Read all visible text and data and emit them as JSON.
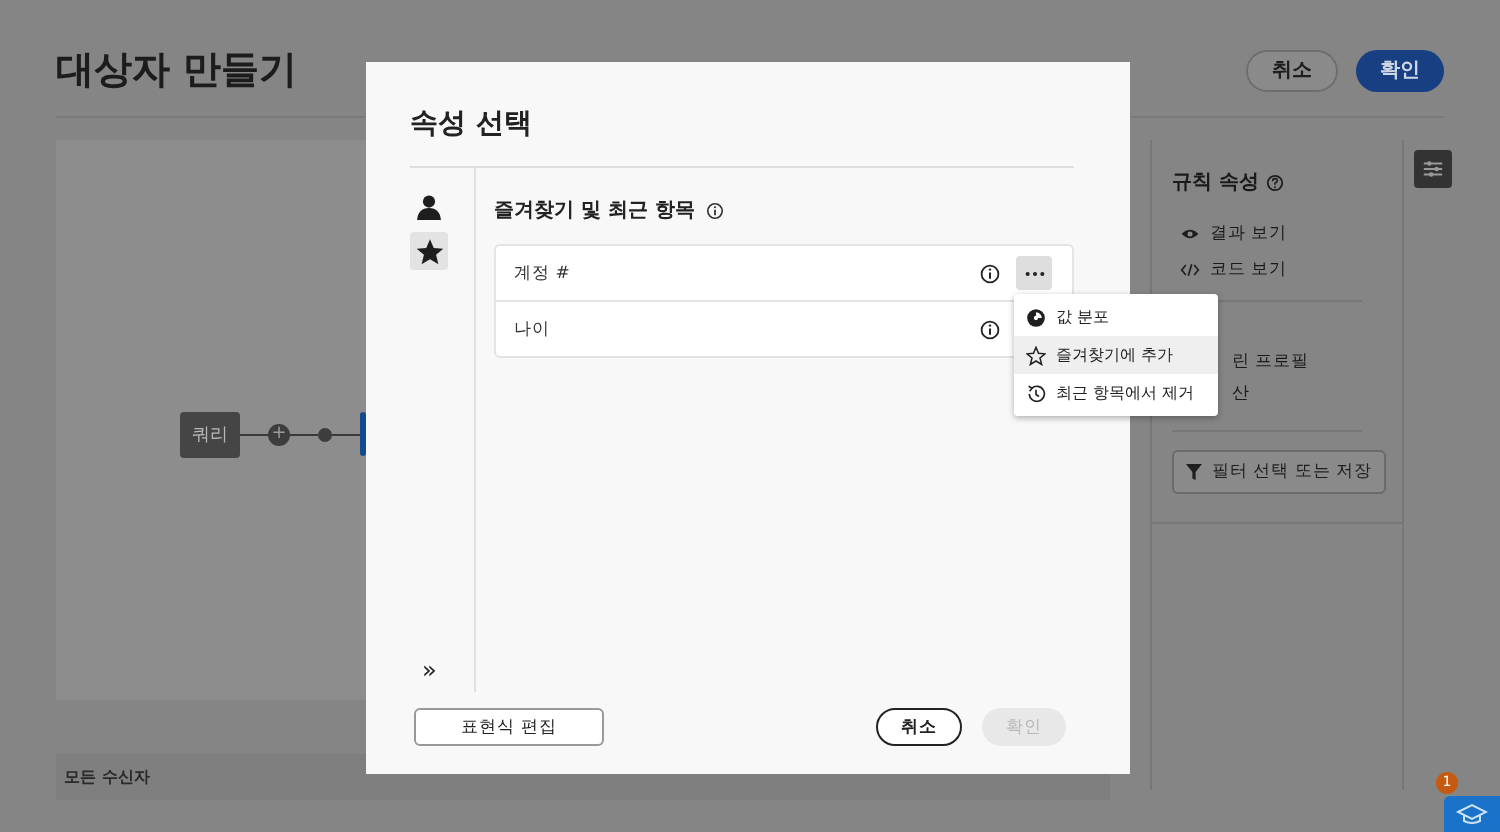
{
  "page": {
    "title": "대상자 만들기",
    "buttons": [
      {
        "label": "취소",
        "kind": "secondary"
      },
      {
        "label": "확인",
        "kind": "primary"
      }
    ]
  },
  "canvas": {
    "nodes": [
      {
        "label": "쿼리",
        "kind": "query"
      },
      {
        "label": "+",
        "kind": "add"
      },
      {
        "kind": "dot"
      },
      {
        "kind": "step"
      }
    ],
    "footer": "모든 수신자"
  },
  "rule_panel": {
    "title": "규칙 속성",
    "links": [
      {
        "label": "결과 보기",
        "kind": "eye"
      },
      {
        "label": "코드 보기",
        "kind": "code"
      }
    ],
    "partial_texts": [
      "린 프로필",
      "산"
    ],
    "filter_button": "필터 선택 또는 저장"
  },
  "dialog": {
    "title": "속성 선택",
    "rail": [
      {
        "kind": "person",
        "selected": false
      },
      {
        "kind": "star",
        "selected": true
      }
    ],
    "expand": "»",
    "section_title": "즐겨찾기 및 최근 항목",
    "rows": [
      {
        "label": "계정 #",
        "menu_open": true
      },
      {
        "label": "나이"
      }
    ],
    "menu": [
      {
        "label": "값 분포",
        "kind": "distribution",
        "selected": false
      },
      {
        "label": "즐겨찾기에 추가",
        "kind": "star",
        "selected": true
      },
      {
        "label": "최근 항목에서 제거",
        "kind": "history",
        "selected": false
      }
    ],
    "edit_button": "표현식 편집",
    "cancel": {
      "label": "취소",
      "disabled": false
    },
    "confirm": {
      "label": "확인",
      "disabled": true
    }
  },
  "help": {
    "badge": "1"
  }
}
